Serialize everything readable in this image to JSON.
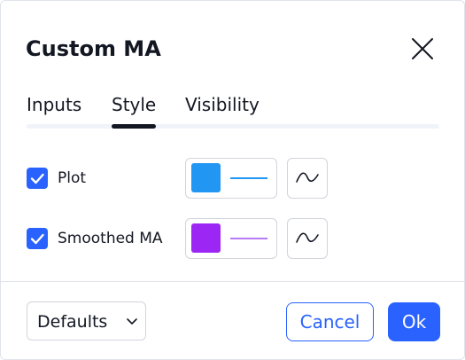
{
  "dialog": {
    "title": "Custom MA",
    "close_icon": "close-icon"
  },
  "tabs": [
    {
      "label": "Inputs",
      "active": false
    },
    {
      "label": "Style",
      "active": true
    },
    {
      "label": "Visibility",
      "active": false
    }
  ],
  "style_rows": [
    {
      "label": "Plot",
      "checked": true,
      "color": "#2196f3",
      "line_color": "#2196f3",
      "type_icon": "line-type-icon"
    },
    {
      "label": "Smoothed MA",
      "checked": true,
      "color": "#9c27f5",
      "line_color": "#b57cf5",
      "type_icon": "line-type-icon"
    }
  ],
  "footer": {
    "defaults_label": "Defaults",
    "cancel_label": "Cancel",
    "ok_label": "Ok"
  },
  "colors": {
    "accent": "#2962ff",
    "text": "#131722",
    "border": "#d1d4dc"
  }
}
